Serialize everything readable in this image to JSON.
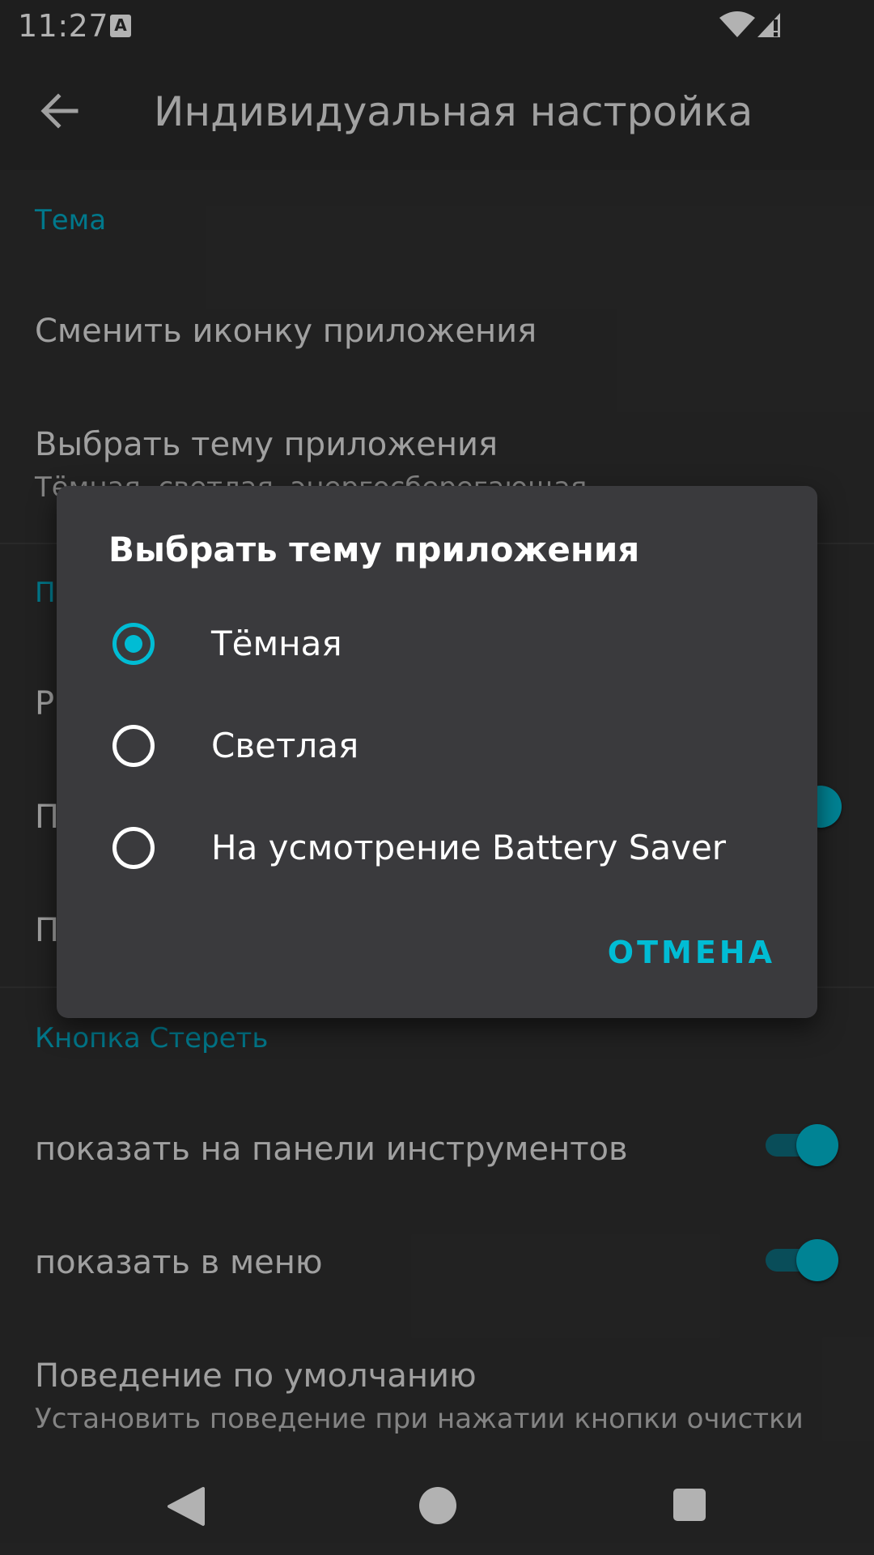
{
  "status_bar": {
    "time": "11:27",
    "notification_letter": "A",
    "wifi_icon": "wifi-icon",
    "signal_icon": "cell-signal-icon"
  },
  "app_bar": {
    "title": "Индивидуальная настройка",
    "back_icon": "arrow-back-icon"
  },
  "settings": {
    "section_theme": "Тема",
    "change_icon": "Сменить иконку приложения",
    "choose_theme_title": "Выбрать тему приложения",
    "choose_theme_subtitle": "Тёмная, светлая, энергосберегающая",
    "section_2_partial": "П",
    "item_partial_1": "Р",
    "item_partial_2": "П",
    "item_partial_3": "П",
    "section_clear": "Кнопка Стереть",
    "show_in_toolbar": "показать на панели инструментов",
    "show_in_menu": "показать в меню",
    "default_behavior_title": "Поведение по умолчанию",
    "default_behavior_subtitle": "Установить поведение при нажатии кнопки очистки"
  },
  "dialog": {
    "title": "Выбрать тему приложения",
    "options": [
      {
        "label": "Тёмная",
        "selected": true
      },
      {
        "label": "Светлая",
        "selected": false
      },
      {
        "label": "На усмотрение Battery Saver",
        "selected": false
      }
    ],
    "cancel_label": "ОТМЕНА"
  },
  "colors": {
    "accent": "#00bcd4",
    "background": "#303030",
    "dialog": "#3a3a3d"
  },
  "nav_bar": {
    "back_icon": "nav-back-icon",
    "home_icon": "nav-home-icon",
    "recents_icon": "nav-recents-icon"
  }
}
